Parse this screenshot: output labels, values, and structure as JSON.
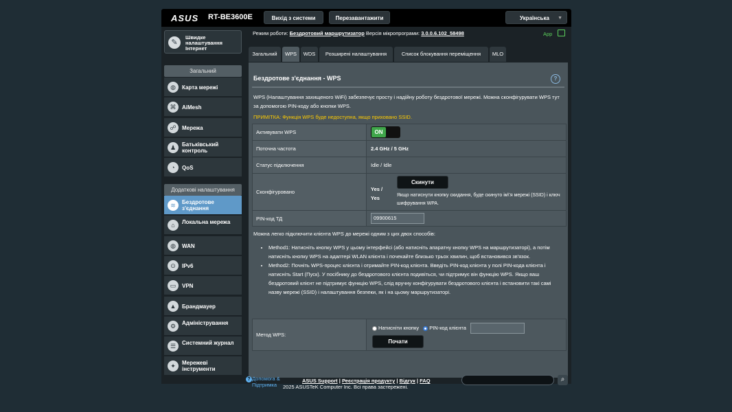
{
  "header": {
    "logo": "ASUS",
    "model": "RT-BE3600E",
    "logout_label": "Вихід з системи",
    "reboot_label": "Перезавантажити",
    "language": "Українська"
  },
  "sidebar": {
    "quick_setup": "Швидке налаштування Інтернет",
    "general_heading": "Загальний",
    "general_items": [
      {
        "label": "Карта мережі",
        "icon": "globe-icon"
      },
      {
        "label": "AiMesh",
        "icon": "mesh-icon"
      },
      {
        "label": "Мережа",
        "icon": "people-icon"
      },
      {
        "label": "Батьківський контроль",
        "icon": "family-icon"
      },
      {
        "label": "QoS",
        "icon": "speedometer-icon"
      }
    ],
    "advanced_heading": "Додаткові налаштування",
    "advanced_items": [
      {
        "label": "Бездротове з'єднання",
        "icon": "wifi-icon"
      },
      {
        "label": "Локальна мережа",
        "icon": "home-icon"
      },
      {
        "label": "WAN",
        "icon": "globe-icon"
      },
      {
        "label": "IPv6",
        "icon": "ipv6-icon"
      },
      {
        "label": "VPN",
        "icon": "vpn-icon"
      },
      {
        "label": "Брандмауер",
        "icon": "firewall-icon"
      },
      {
        "label": "Адміністрування",
        "icon": "admin-icon"
      },
      {
        "label": "Системний журнал",
        "icon": "log-icon"
      },
      {
        "label": "Мережеві інструменти",
        "icon": "tools-icon"
      }
    ]
  },
  "opmode": {
    "prefix": "Режим роботи:",
    "mode": "Бездротовий маршрутизатор",
    "firmware_prefix": "Версія мікропрограми:",
    "firmware": "3.0.0.6.102_58498",
    "app_label": "App"
  },
  "tabs": [
    "Загальний",
    "WPS",
    "WDS",
    "Розширені налаштування",
    "Список блокування переміщення",
    "MLO"
  ],
  "page": {
    "title": "Бездротове з'єднання - WPS",
    "help": "?",
    "description": "WPS (Налаштування захищеного WiFi) забезпечує просту і надійну роботу бездротової мережі. Можна сконфігурувати WPS тут за допомогою PIN-коду або кнопки WPS.",
    "note": "ПРИМІТКА: Функція WPS буде недоступна, якщо приховано SSID.",
    "enable_label": "Активувати WPS",
    "enable_value": "ON",
    "freq_label": "Поточна частота",
    "freq_value": "2.4 GHz / 5 GHz",
    "status_label": "Статус підключення",
    "status_value": "Idle / Idle",
    "configured_label": "Сконфігуровано",
    "configured_value_1": "Yes /",
    "configured_value_2": "Yes",
    "reset_button": "Скинути",
    "reset_note": "Якщо натиснути кнопку скидання, буде скинуто ім\\'я мережі (SSID) і ключ шифрування WPA.",
    "pin_label": "PIN-код ТД",
    "pin_value": "09900615",
    "info_intro": "Можна легко підключити клієнта WPS до мережі одним з цих двох способів:",
    "method1": "Method1: Натисніть кнопку WPS у цьому інтерфейсі (або натисніть апаратну кнопку WPS на маршрутизаторі), а потім натисніть кнопку WPS на адаптері WLAN клієнта і почекайте близько трьох хвилин, щоб встановився зв'язок.",
    "method2": "Method2: Почніть WPS-процес клієнта і отримайте PIN-код клієнта. Введіть PIN-код клієнта у полі PIN-кода клієнта і натисніть Start (Пуск). У посібнику до бездротового клієнта подивіться, чи підтримує він функцію WPS. Якщо ваш бездротовий клієнт не підтримує функцію WPS, слід вручну конфігурувати бездротового клієнта і встановити такі самі назву мережі (SSID) і налаштування безпеки, як і на цьому маршрутизаторі.",
    "method_label": "Метод WPS:",
    "radio_button": "Натисніти кнопку",
    "radio_pin": "PIN-код клієнта",
    "start_button": "Почати"
  },
  "footer": {
    "help_support": "Допомога & Підтримка",
    "asus_support": "ASUS Support",
    "register": "Реєстрація продукту",
    "feedback": "Відгук",
    "faq": "FAQ",
    "copyright": "2025 ASUSTeK Computer Inc. Всі права застережені."
  }
}
